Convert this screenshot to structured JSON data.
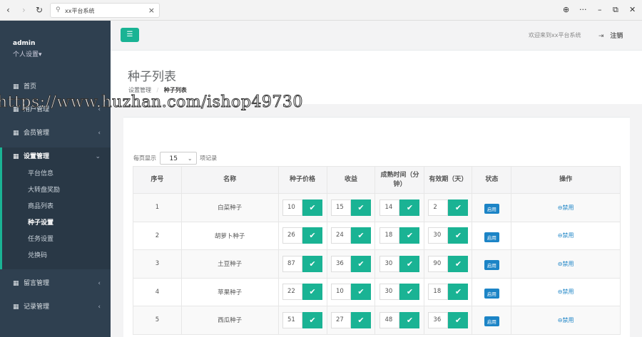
{
  "browser": {
    "back": "‹",
    "forward": "›",
    "reload": "↻",
    "tab_title": "xx平台系统",
    "close": "×",
    "globe": "⊕",
    "more": "···",
    "minimize": "–",
    "restore": "⧉",
    "win_close": "✕"
  },
  "sidebar": {
    "username": "admin",
    "user_settings": "个人设置▾",
    "menu": [
      {
        "icon": "▦",
        "label": "首页",
        "arrow": ""
      },
      {
        "icon": "▦",
        "label": "用户管理",
        "arrow": "‹"
      },
      {
        "icon": "▦",
        "label": "会员管理",
        "arrow": "‹"
      },
      {
        "icon": "▦",
        "label": "设置管理",
        "arrow": "⌄"
      }
    ],
    "submenu": [
      "平台信息",
      "大转盘奖励",
      "商品列表",
      "种子设置",
      "任务设置",
      "兑换码"
    ],
    "menu_bottom": [
      {
        "icon": "▦",
        "label": "留言管理",
        "arrow": "‹"
      },
      {
        "icon": "▦",
        "label": "记录管理",
        "arrow": "‹"
      }
    ]
  },
  "header": {
    "hamburger": "☰",
    "welcome": "欢迎来到xx平台系统",
    "logout_icon": "⇥",
    "logout": "注销"
  },
  "page": {
    "title": "种子列表",
    "crumb_parent": "设置管理",
    "crumb_sep": "/",
    "crumb_current": "种子列表"
  },
  "table_controls": {
    "per_page_label": "每页显示",
    "per_page_value": "15",
    "per_page_suffix": "项记录",
    "chevron": "⌄"
  },
  "table": {
    "headers": [
      "序号",
      "名称",
      "种子价格",
      "收益",
      "成熟时间（分钟）",
      "有效期（天）",
      "状态",
      "操作"
    ],
    "check": "✔",
    "rows": [
      {
        "id": "1",
        "name": "白菜种子",
        "price": "10",
        "income": "15",
        "mature": "14",
        "valid": "2",
        "status": "启用",
        "action": "⊖禁用"
      },
      {
        "id": "2",
        "name": "胡萝卜种子",
        "price": "26",
        "income": "24",
        "mature": "18",
        "valid": "30",
        "status": "启用",
        "action": "⊖禁用"
      },
      {
        "id": "3",
        "name": "土豆种子",
        "price": "87",
        "income": "36",
        "mature": "30",
        "valid": "90",
        "status": "启用",
        "action": "⊖禁用"
      },
      {
        "id": "4",
        "name": "苹果种子",
        "price": "22",
        "income": "10",
        "mature": "30",
        "valid": "18",
        "status": "启用",
        "action": "⊖禁用"
      },
      {
        "id": "5",
        "name": "西瓜种子",
        "price": "51",
        "income": "27",
        "mature": "48",
        "valid": "36",
        "status": "启用",
        "action": "⊖禁用"
      }
    ]
  },
  "watermark": "https://www.huzhan.com/ishop49730",
  "colors": {
    "accent": "#1ab394",
    "sidebar": "#2f4050",
    "badge": "#1c84c6"
  }
}
